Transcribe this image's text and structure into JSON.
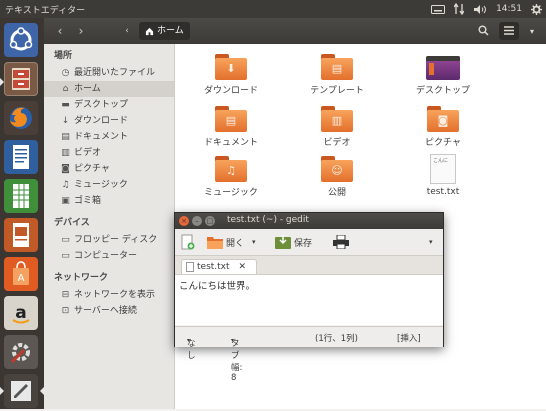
{
  "topbar": {
    "app_title": "テキストエディター",
    "clock": "14:51"
  },
  "nav": {
    "crumb": "ホーム"
  },
  "sidebar": {
    "sections": {
      "places": "場所",
      "devices": "デバイス",
      "network": "ネットワーク"
    },
    "items": [
      {
        "label": "最近開いたファイル",
        "icon": "clock-icon"
      },
      {
        "label": "ホーム",
        "icon": "home-icon"
      },
      {
        "label": "デスクトップ",
        "icon": "desktop-folder-icon"
      },
      {
        "label": "ダウンロード",
        "icon": "download-icon"
      },
      {
        "label": "ドキュメント",
        "icon": "document-icon"
      },
      {
        "label": "ビデオ",
        "icon": "film-icon"
      },
      {
        "label": "ピクチャ",
        "icon": "camera-icon"
      },
      {
        "label": "ミュージック",
        "icon": "music-icon"
      },
      {
        "label": "ゴミ箱",
        "icon": "trash-icon"
      },
      {
        "label": "フロッピー ディスク",
        "icon": "floppy-icon"
      },
      {
        "label": "コンピューター",
        "icon": "drive-icon"
      },
      {
        "label": "ネットワークを表示",
        "icon": "network-icon"
      },
      {
        "label": "サーバーへ接続",
        "icon": "server-icon"
      }
    ]
  },
  "files": [
    {
      "label": "ダウンロード",
      "icon": "download-folder-icon"
    },
    {
      "label": "テンプレート",
      "icon": "templates-folder-icon"
    },
    {
      "label": "デスクトップ",
      "icon": "desktop-folder-icon"
    },
    {
      "label": "ドキュメント",
      "icon": "documents-folder-icon"
    },
    {
      "label": "ビデオ",
      "icon": "videos-folder-icon"
    },
    {
      "label": "ピクチャ",
      "icon": "pictures-folder-icon"
    },
    {
      "label": "ミュージック",
      "icon": "music-folder-icon"
    },
    {
      "label": "公開",
      "icon": "public-folder-icon"
    },
    {
      "label": "test.txt",
      "icon": "text-file-icon",
      "preview": "こんに"
    }
  ],
  "gedit": {
    "title": "test.txt (~) - gedit",
    "toolbar": {
      "open": "開く",
      "save": "保存"
    },
    "tab": "test.txt",
    "content": "こんにちは世界。",
    "status": {
      "syntax": "なし",
      "tab_width": "タブ幅: 8",
      "position": "(1行、1列)",
      "mode": "[挿入]"
    }
  },
  "colors": {
    "topbar": "#3c3b37",
    "launcher": "#3b3632",
    "folder": "#e3702c",
    "accent": "#dd4814"
  }
}
